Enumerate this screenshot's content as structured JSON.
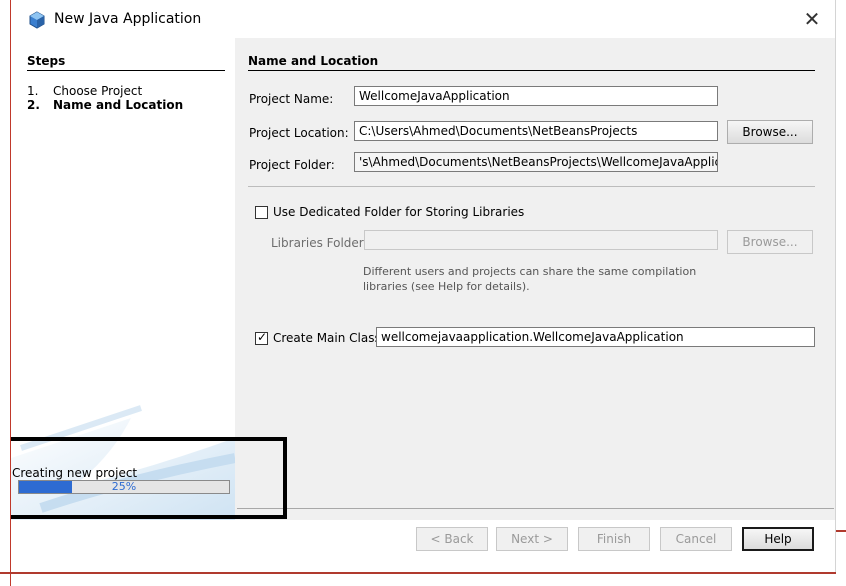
{
  "window": {
    "title": "New Java Application",
    "close_glyph": "✕",
    "app_icon": "java-cube-icon"
  },
  "steps": {
    "title": "Steps",
    "items": [
      {
        "num": "1.",
        "label": "Choose Project"
      },
      {
        "num": "2.",
        "label": "Name and Location"
      }
    ]
  },
  "progress": {
    "label": "Creating new project",
    "percent": 25,
    "percent_text": "25%"
  },
  "form": {
    "section_title": "Name and Location",
    "project_name_label": "Project Name:",
    "project_name_value": "WellcomeJavaApplication",
    "project_location_label": "Project Location:",
    "project_location_value": "C:\\Users\\Ahmed\\Documents\\NetBeansProjects",
    "browse_label": "Browse...",
    "project_folder_label": "Project Folder:",
    "project_folder_value": "'s\\Ahmed\\Documents\\NetBeansProjects\\WellcomeJavaApplication",
    "dedicated_folder_label": "Use Dedicated Folder for Storing Libraries",
    "dedicated_folder_checked": false,
    "libraries_folder_label": "Libraries Folder:",
    "libraries_folder_value": "",
    "libraries_browse_label": "Browse...",
    "hint": "Different users and projects can share the same compilation libraries (see Help for details).",
    "main_class_label": "Create Main Class",
    "main_class_checked": true,
    "main_class_value": "wellcomejavaapplication.WellcomeJavaApplication"
  },
  "buttons": {
    "back": "< Back",
    "next": "Next >",
    "finish": "Finish",
    "cancel": "Cancel",
    "help": "Help"
  },
  "colors": {
    "accent": "#2d6bd2",
    "panel_bg": "#f0f0f0"
  }
}
